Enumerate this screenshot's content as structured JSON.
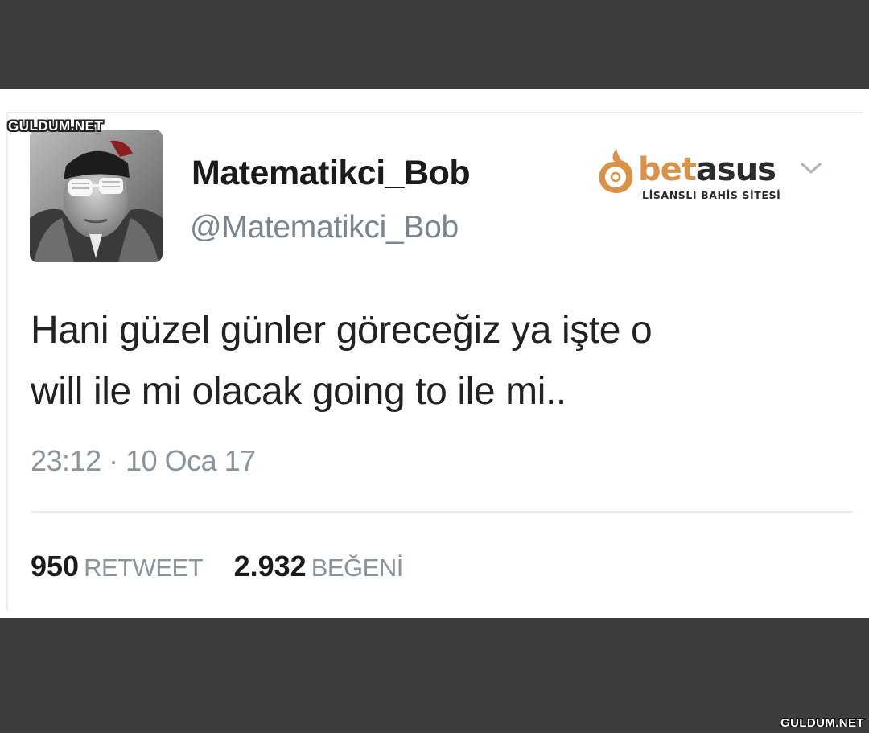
{
  "watermark": "GULDUM.NET",
  "tweet": {
    "display_name": "Matematikci_Bob",
    "handle": "@Matematikci_Bob",
    "text_line1": "Hani güzel günler göreceğiz ya işte o",
    "text_line2": "will ile mi olacak going to ile mi..",
    "timestamp": "23:12 · 10 Oca 17",
    "retweets_count": "950",
    "retweets_label": "RETWEET",
    "likes_count": "2.932",
    "likes_label": "BEĞENİ"
  },
  "brand": {
    "name_part1": "bet",
    "name_part2": "asus",
    "tagline": "LİSANSLI BAHİS SİTESİ",
    "accent_color": "#d9924a"
  },
  "icons": {
    "menu": "chevron-down-icon",
    "avatar": "avatar-photo"
  },
  "colors": {
    "frame_bg": "#3d3d3d",
    "card_bg": "#ffffff",
    "text_primary": "#1b1b1b",
    "text_secondary": "#8a949c"
  }
}
